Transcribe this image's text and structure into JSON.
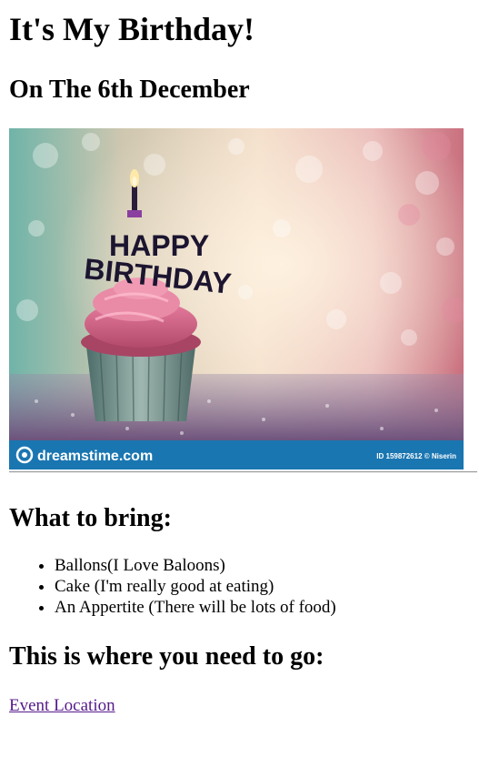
{
  "page": {
    "title": "It's My Birthday!",
    "subtitle": "On The 6th December"
  },
  "image": {
    "topper_line1": "HAPPY",
    "topper_line2": "BIRTHDAY",
    "watermark_brand": "dreamstime.com",
    "watermark_id": "ID 159872612 © Niserin"
  },
  "bring": {
    "heading": "What to bring:",
    "items": [
      "Ballons(I Love Baloons)",
      "Cake (I'm really good at eating)",
      "An Appertite (There will be lots of food)"
    ]
  },
  "location": {
    "heading": "This is where you need to go:",
    "link_text": "Event Location"
  }
}
